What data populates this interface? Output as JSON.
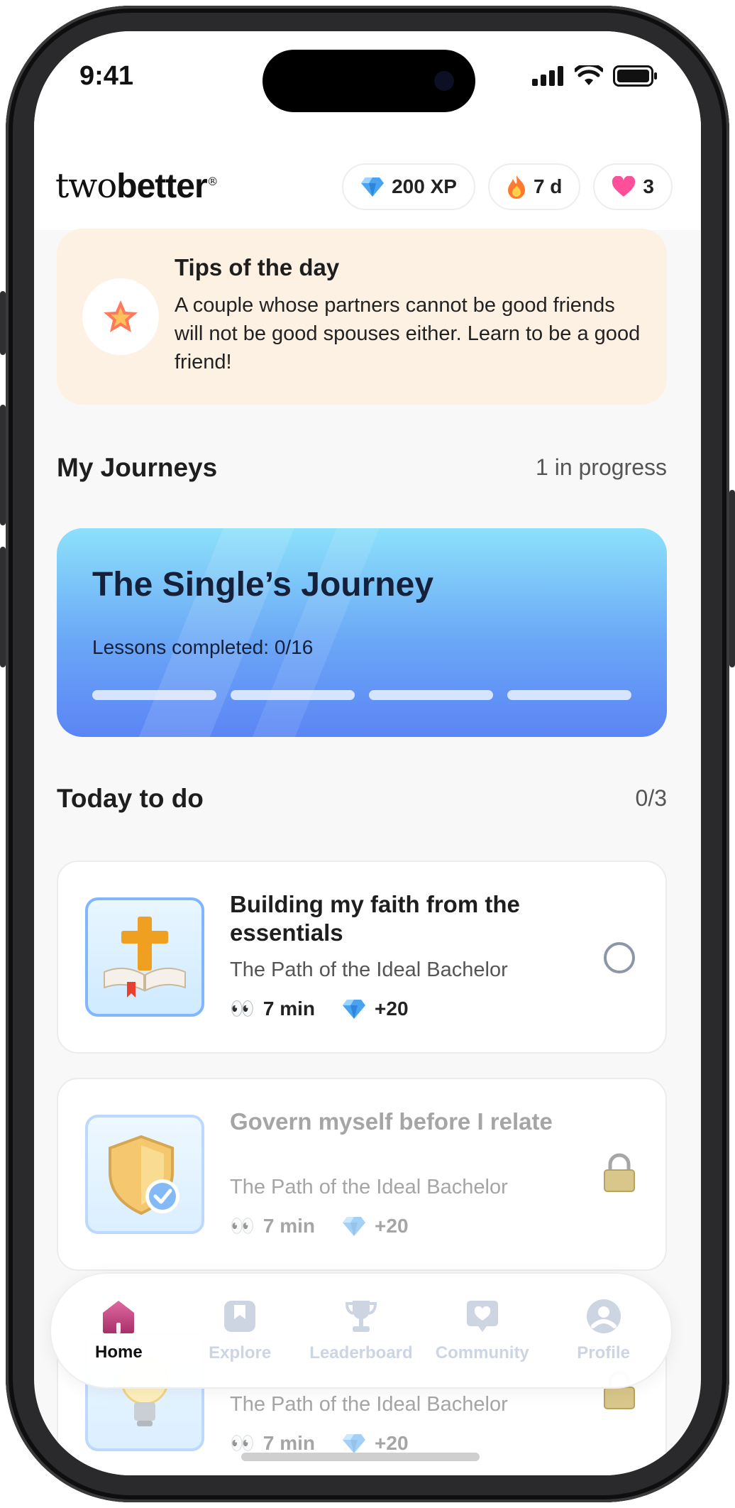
{
  "status_bar": {
    "time": "9:41"
  },
  "header": {
    "logo_prefix": "two",
    "logo_bold": "better",
    "logo_mark": "®",
    "xp": "200 XP",
    "streak": "7 d",
    "hearts": "3"
  },
  "tip": {
    "title": "Tips of the day",
    "text": "A couple whose partners cannot be good friends will not be good spouses either. Learn to be a good friend!"
  },
  "journeys": {
    "title": "My Journeys",
    "meta": "1 in progress",
    "card": {
      "title": "The Single’s Journey",
      "lessons": "Lessons completed: 0/16",
      "progress_segments": 4,
      "completed_segments": 0
    }
  },
  "today": {
    "title": "Today to do",
    "meta": "0/3",
    "tasks": [
      {
        "title": "Building my faith from the essentials",
        "path": "The Path of the Ideal Bachelor",
        "duration_icon": "👀",
        "duration": "7 min",
        "reward": "+20",
        "status": "open",
        "icon": "bible-cross-icon"
      },
      {
        "title": "Govern myself before I relate",
        "path": "The Path of the Ideal Bachelor",
        "duration_icon": "👀",
        "duration": "7 min",
        "reward": "+20",
        "status": "locked",
        "icon": "shield-check-icon"
      },
      {
        "title": "",
        "path": "The Path of the Ideal Bachelor",
        "duration_icon": "👀",
        "duration": "7 min",
        "reward": "+20",
        "status": "locked",
        "icon": "lightbulb-icon"
      }
    ]
  },
  "nav": {
    "items": [
      {
        "label": "Home",
        "icon": "home-icon",
        "active": true
      },
      {
        "label": "Explore",
        "icon": "bookmark-icon",
        "active": false
      },
      {
        "label": "Leaderboard",
        "icon": "trophy-icon",
        "active": false
      },
      {
        "label": "Community",
        "icon": "heart-bubble-icon",
        "active": false
      },
      {
        "label": "Profile",
        "icon": "profile-icon",
        "active": false
      }
    ]
  },
  "colors": {
    "tip_bg": "#fdf1e4",
    "journey_top": "#8ce1fb",
    "journey_bottom": "#5b85f5",
    "nav_active": "#c0467f",
    "nav_inactive": "#cdd5e3"
  }
}
